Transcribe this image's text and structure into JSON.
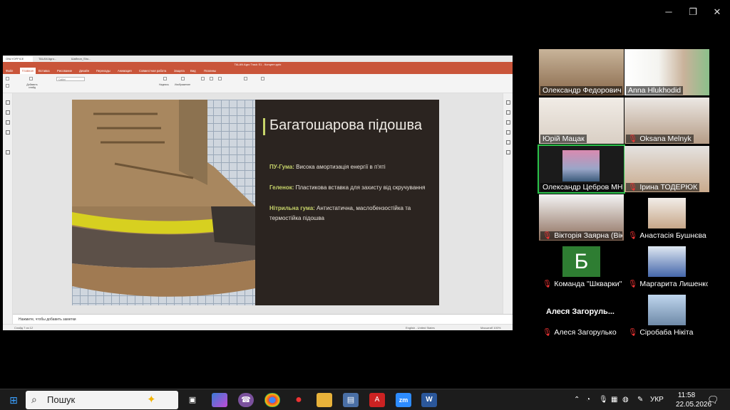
{
  "window_controls": {
    "minimize": "─",
    "restore": "❐",
    "close": "✕"
  },
  "app": {
    "tabs": [
      "ONLYOFFICE",
      "TALAN Agro...",
      "Шаблон_Sho..."
    ],
    "title": "TALAN Agro Track S1 - Концепт.pptx",
    "menu": [
      "Файл",
      "Главная",
      "Вставка",
      "Рисование",
      "Дизайн",
      "Переходы",
      "Анимация",
      "Совместная работа",
      "Защита",
      "Вид",
      "Плагины"
    ],
    "active_menu": "Главная",
    "toolbar": {
      "add_slide": "Добавить слайд",
      "font": "Calibri",
      "caption": "Надпись",
      "image": "Изображение"
    },
    "notes_placeholder": "Нажмите, чтобы добавить заметки",
    "status_left": "Слайд 7 из 12",
    "status_lang": "English - United States",
    "status_zoom": "Масштаб 100%"
  },
  "slide": {
    "title": "Багатошарова підошва",
    "bullets": [
      {
        "label": "ПУ-Гума:",
        "text": " Висока амортизація енергії в п'яті"
      },
      {
        "label": "Геленок:",
        "text": " Пластикова вставка для захисту від скручування"
      },
      {
        "label": "Нітрильна гума:",
        "text": " Антистатична, маслобензостійка та термостійка підошва"
      }
    ]
  },
  "participants": [
    {
      "name": "Олександр Федорович",
      "muted": false
    },
    {
      "name": "Anna Hlukhodid",
      "muted": false
    },
    {
      "name": "Юрій Мацак",
      "muted": false
    },
    {
      "name": "Oksana Melnyk",
      "muted": true
    },
    {
      "name": "Олександр Цебров МН...",
      "muted": false
    },
    {
      "name": "Ірина ТОДЕРЮК",
      "muted": true
    },
    {
      "name": "Вікторія Заярна (Вікт...",
      "muted": true
    },
    {
      "name": "Анастасія Бушнєва",
      "muted": true
    },
    {
      "name": "Команда \"Шкварки\"",
      "muted": true,
      "avatar_letter": "Б"
    },
    {
      "name": "Маргарита Лишенко...",
      "muted": true
    },
    {
      "name": "Алеся Загорулько",
      "muted": true,
      "header": "Алеся  Загоруль..."
    },
    {
      "name": "Сіробаба Нікіта",
      "muted": true
    }
  ],
  "taskbar": {
    "search_placeholder": "Пошук",
    "lang": "УКР",
    "time": "11:58",
    "date": "22.05.2026"
  },
  "colors": {
    "accent": "#c7d46a",
    "office": "#c9553a",
    "active_speaker": "#2bc24a"
  }
}
